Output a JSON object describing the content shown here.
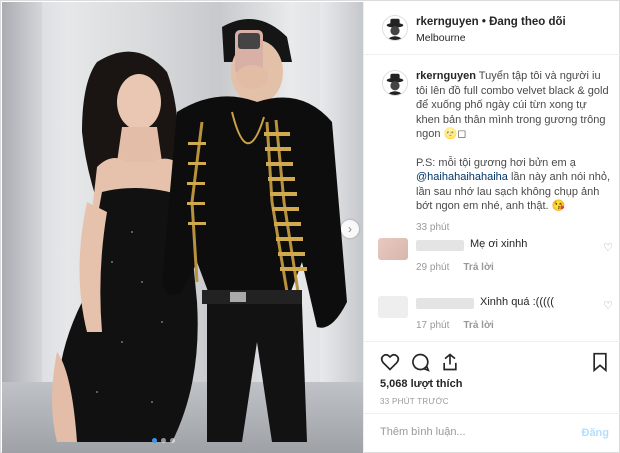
{
  "header": {
    "username": "rkernguyen",
    "separator": "•",
    "follow_status": "Đang theo dõi",
    "location": "Melbourne",
    "more": "···"
  },
  "caption": {
    "username": "rkernguyen",
    "text1": "Tuyển tập tôi và người iu tôi lên đồ full combo velvet black & gold để xuống phố ngày cúi từn xong tự khen bản thân mình trong gương trông ngon 🌝◻",
    "text2_prefix": "P.S: mỗi tội gương hơi bửn em ạ",
    "mention": "@haihahaihahaiha",
    "text2_suffix": "lần này anh nói nhỏ, lần sau nhớ lau sạch không chụp ảnh bớt ngon em nhé, anh thật. 😘",
    "time": "33 phút"
  },
  "comments": [
    {
      "text": "Mẹ ơi xinhh",
      "time": "29 phút",
      "reply": "Trả lời"
    },
    {
      "text": "Xinhh quá :(((((",
      "time": "17 phút",
      "reply": "Trả lời"
    }
  ],
  "likes": "5,068 lượt thích",
  "posted_ago": "33 PHÚT TRƯỚC",
  "add_comment": {
    "placeholder": "Thêm bình luận...",
    "post_label": "Đăng"
  },
  "icons": {
    "heart": "heart-icon",
    "comment": "comment-icon",
    "share": "share-icon",
    "bookmark": "bookmark-icon",
    "nav": "chevron-right-icon"
  },
  "colors": {
    "accent": "#3897f0",
    "post_disabled": "#b2dffc",
    "text": "#262626",
    "muted": "#999999"
  }
}
